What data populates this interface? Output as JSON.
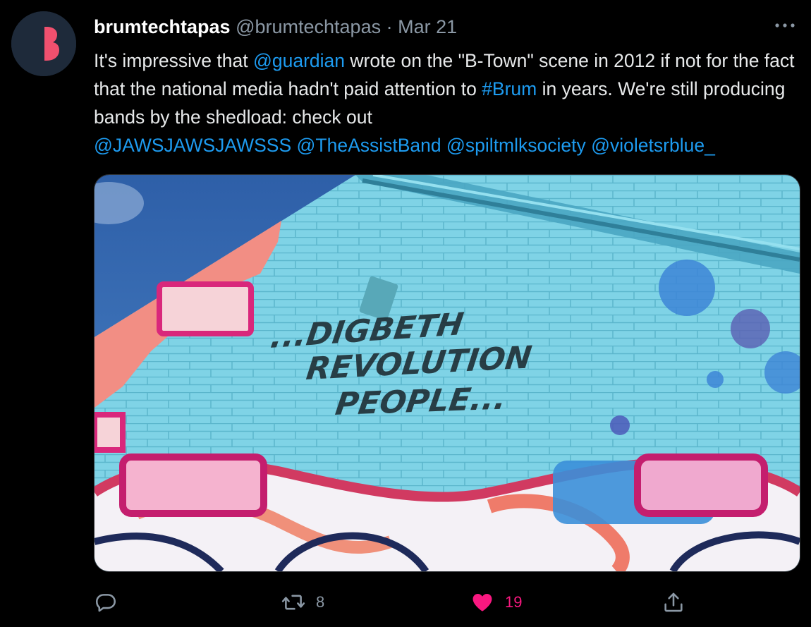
{
  "tweet": {
    "author": {
      "display_name": "brumtechtapas",
      "handle": "@brumtechtapas",
      "separator": "·",
      "date": "Mar 21",
      "avatar_colors": {
        "background": "#1e2a3a",
        "letter": "#f0506e"
      }
    },
    "text": {
      "part1": "It's impressive that ",
      "mention_guardian": "@guardian",
      "part2": " wrote on the \"B-Town\" scene in 2012 if not for the fact that the national media hadn't paid attention to ",
      "hashtag_brum": "#Brum",
      "part3": " in years. We're still producing bands by the shedload: check out ",
      "mention_jaws": "@JAWSJAWSJAWSSS",
      "mention_assist": "@TheAssistBand",
      "mention_spilt": "@spiltmlksociety",
      "mention_violets": "@violetsrblue_"
    },
    "media": {
      "mural_text": {
        "line1": "...DIGBETH",
        "line2": "REVOLUTION",
        "line3": "PEOPLE..."
      }
    },
    "actions": {
      "reply_count": "",
      "retweet_count": "8",
      "like_count": "19",
      "liked": true
    },
    "icons": {
      "more": "more-horizontal-icon",
      "reply": "reply-icon",
      "retweet": "retweet-icon",
      "like": "heart-icon",
      "share": "share-icon"
    },
    "colors": {
      "background": "#000000",
      "text": "#e7e9ea",
      "secondary": "#8b98a5",
      "link": "#1d9bf0",
      "like": "#f91880"
    }
  }
}
